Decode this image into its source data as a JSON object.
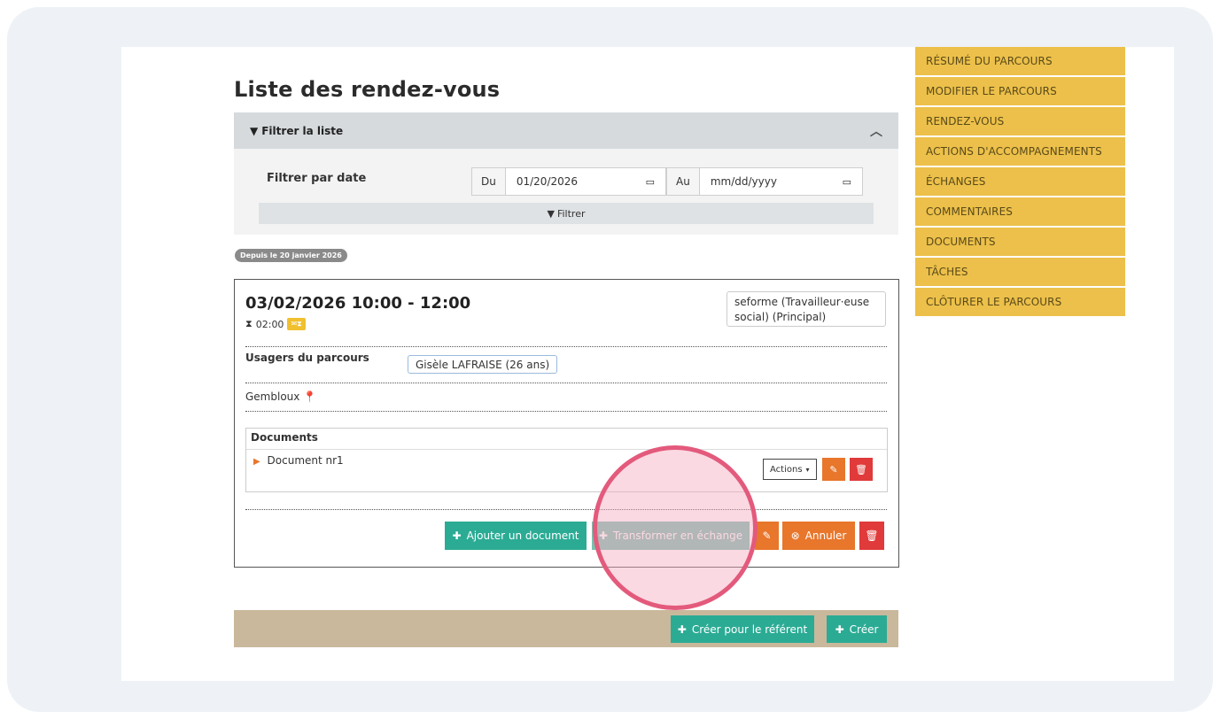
{
  "page": {
    "title": "Liste des rendez-vous"
  },
  "filter": {
    "header_label": "Filtrer la liste",
    "by_date_label": "Filtrer par date",
    "from_addon": "Du",
    "from_value": "01/20/2026",
    "to_addon": "Au",
    "to_placeholder": "mm/dd/yyyy",
    "apply_label": "Filtrer"
  },
  "since_badge": "Depuis le 20 janvier 2026",
  "appointment": {
    "time": "03/02/2026 10:00 - 12:00",
    "duration": "02:00",
    "worker": "seforme (Travailleur·euse social) (Principal)",
    "usagers_label": "Usagers du parcours",
    "usager": "Gisèle LAFRAISE (26 ans)",
    "location": "Gembloux",
    "documents_title": "Documents",
    "document_name": "Document nr1",
    "actions_label": "Actions",
    "add_document": "Ajouter un document",
    "transform_label": "Transformer en échange",
    "cancel_label": "Annuler"
  },
  "create_bar": {
    "create_for_referent": "Créer pour le référent",
    "create": "Créer"
  },
  "nav": {
    "items": [
      "RÉSUMÉ DU PARCOURS",
      "MODIFIER LE PARCOURS",
      "RENDEZ-VOUS",
      "ACTIONS D'ACCOMPAGNEMENTS",
      "ÉCHANGES",
      "COMMENTAIRES",
      "DOCUMENTS",
      "TÂCHES",
      "CLÔTURER LE PARCOURS"
    ]
  },
  "colors": {
    "nav": "#ecc04a",
    "teal": "#2bab94",
    "orange": "#e8762b",
    "red": "#e03a3a",
    "highlight": "#e35a7c"
  }
}
